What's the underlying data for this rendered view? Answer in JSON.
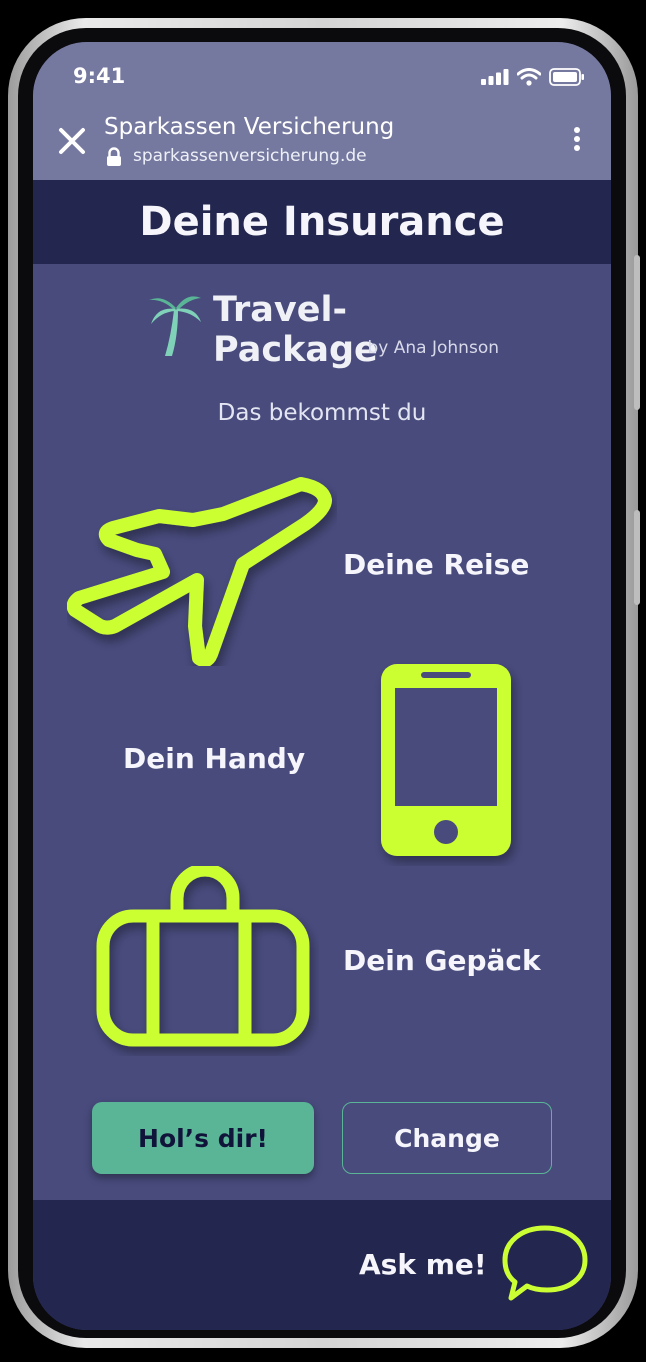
{
  "status_bar": {
    "time": "9:41"
  },
  "browser": {
    "title": "Sparkassen Versicherung",
    "url": "sparkassenversicherung.de"
  },
  "header": {
    "title": "Deine Insurance"
  },
  "brand": {
    "name": "Travel-Package",
    "byline": "by Ana Johnson"
  },
  "intro": "Das bekommst du",
  "features": [
    {
      "label": "Deine Reise",
      "icon": "airplane-icon"
    },
    {
      "label": "Dein Handy",
      "icon": "smartphone-icon"
    },
    {
      "label": "Dein Gepäck",
      "icon": "suitcase-icon"
    }
  ],
  "actions": {
    "primary_label": "Hol’s dir!",
    "secondary_label": "Change"
  },
  "chat": {
    "label": "Ask me!",
    "icon": "chat-bubble-icon"
  },
  "colors": {
    "accent": "#ccff33",
    "primary_button": "#5ab596",
    "background": "#484b7c",
    "header_bar": "#23264f",
    "browser_bar": "#76799f"
  }
}
